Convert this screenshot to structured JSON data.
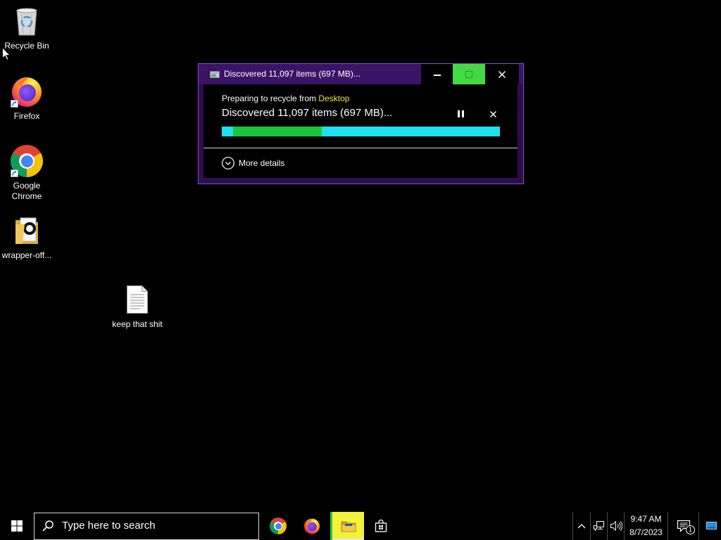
{
  "desktop": {
    "icons": [
      {
        "label": "Recycle Bin",
        "icon": "recycle-bin-icon"
      },
      {
        "label": "Firefox",
        "icon": "firefox-icon",
        "shortcut": true
      },
      {
        "label": "Google Chrome",
        "icon": "chrome-icon",
        "shortcut": true
      },
      {
        "label": "wrapper-off...",
        "icon": "folder-icon"
      },
      {
        "label": "keep that shit",
        "icon": "text-document-icon"
      }
    ]
  },
  "dialog": {
    "title": "Discovered 11,097 items (697 MB)...",
    "title_icon": "file-operation-icon",
    "window_buttons": {
      "minimize": "minimize-icon",
      "maximize": "maximize-icon",
      "close": "close-icon"
    },
    "operation": {
      "prefix": "Preparing to recycle from",
      "location": "Desktop"
    },
    "status": "Discovered 11,097 items (697 MB)...",
    "controls": {
      "pause": "pause-icon",
      "cancel": "close-icon"
    },
    "progress": {
      "fill_from_pct": 4,
      "fill_to_pct": 36
    },
    "more_details": "More details",
    "more_details_icon": "chevron-down-circle-icon"
  },
  "taskbar": {
    "start_icon": "windows-logo-icon",
    "search": {
      "placeholder": "Type here to search",
      "icon": "search-icon"
    },
    "apps": [
      {
        "icon": "chrome-icon",
        "active": false
      },
      {
        "icon": "firefox-icon",
        "active": false
      },
      {
        "icon": "file-explorer-icon",
        "active": true
      },
      {
        "icon": "store-icon",
        "active": false
      }
    ],
    "tray": {
      "icons": [
        "chevron-up-icon",
        "network-icon",
        "volume-icon"
      ],
      "clock": {
        "time": "9:47 AM",
        "date": "8/7/2023"
      },
      "notifications": {
        "icon": "action-center-icon",
        "badge": "1"
      },
      "extra_icon": "monitor-icon"
    }
  },
  "colors": {
    "titlebar": "#3b1367",
    "window_frame": "#2c0d4d",
    "window_border": "#8e4fd0",
    "link_yellow": "#f2e838",
    "progress_track": "#1fe0ee",
    "progress_fill": "#1cc63c",
    "maximize_highlight": "#43d943",
    "taskbar_active": "#f2f23a",
    "taskbar_active_edge": "#2fc43a",
    "tray_blue": "#1c8fe0"
  }
}
